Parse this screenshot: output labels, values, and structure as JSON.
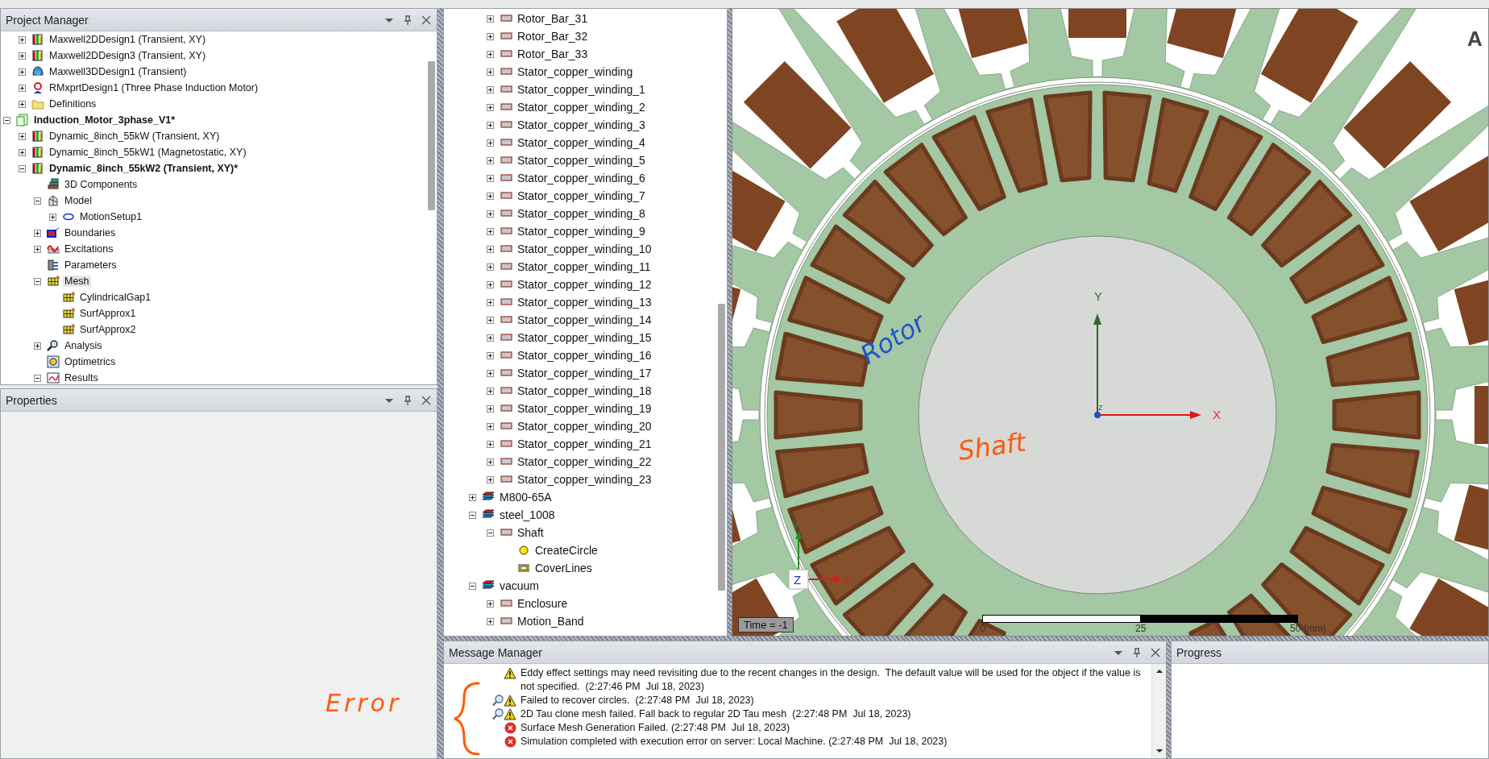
{
  "project_manager": {
    "title": "Project Manager",
    "continued_items": [
      {
        "label": "Maxwell2DDesign1 (Transient, XY)",
        "kind": "design2d",
        "expanded": false,
        "selected": false,
        "active": false
      },
      {
        "label": "Maxwell2DDesign3 (Transient, XY)",
        "kind": "design2d",
        "expanded": false,
        "selected": false,
        "active": false
      },
      {
        "label": "Maxwell3DDesign1 (Transient)",
        "kind": "design3d",
        "expanded": false,
        "selected": false,
        "active": false
      },
      {
        "label": "RMxprtDesign1 (Three Phase Induction Motor)",
        "kind": "rmxprt",
        "expanded": false,
        "selected": false,
        "active": false
      },
      {
        "label": "Definitions",
        "kind": "folder",
        "expanded": false,
        "selected": false,
        "active": false
      }
    ],
    "items": [
      {
        "label": "Induction_Motor_3phase_V1*",
        "kind": "project",
        "expanded": true,
        "selected": false,
        "active": true,
        "children": [
          {
            "label": "Dynamic_8inch_55kW (Transient, XY)",
            "kind": "design2d",
            "expanded": false,
            "selected": false,
            "active": false
          },
          {
            "label": "Dynamic_8inch_55kW1 (Magnetostatic, XY)",
            "kind": "design2d",
            "expanded": false,
            "selected": false,
            "active": false
          },
          {
            "label": "Dynamic_8inch_55kW2 (Transient, XY)*",
            "kind": "design2d",
            "expanded": true,
            "selected": false,
            "active": true,
            "children": [
              {
                "label": "3D Components",
                "kind": "components",
                "selected": false
              },
              {
                "label": "Model",
                "kind": "model",
                "expanded": true,
                "selected": false,
                "children": [
                  {
                    "label": "MotionSetup1",
                    "kind": "motion",
                    "expanded": false,
                    "selected": false
                  }
                ]
              },
              {
                "label": "Boundaries",
                "kind": "boundary",
                "expanded": false,
                "selected": false
              },
              {
                "label": "Excitations",
                "kind": "excitation",
                "expanded": false,
                "selected": false
              },
              {
                "label": "Parameters",
                "kind": "parameters",
                "selected": false
              },
              {
                "label": "Mesh",
                "kind": "mesh",
                "expanded": true,
                "selected": true,
                "children": [
                  {
                    "label": "CylindricalGap1",
                    "kind": "mesh",
                    "selected": false
                  },
                  {
                    "label": "SurfApprox1",
                    "kind": "mesh",
                    "selected": false
                  },
                  {
                    "label": "SurfApprox2",
                    "kind": "mesh",
                    "selected": false
                  }
                ]
              },
              {
                "label": "Analysis",
                "kind": "analysis",
                "expanded": false,
                "selected": false
              },
              {
                "label": "Optimetrics",
                "kind": "optimetrics",
                "selected": false
              },
              {
                "label": "Results",
                "kind": "results",
                "expanded": true,
                "selected": false
              }
            ]
          }
        ]
      }
    ]
  },
  "properties": {
    "title": "Properties"
  },
  "model_tree": {
    "continued_items": [
      {
        "label": "Rotor_Bar_31",
        "kind": "object",
        "expanded": false
      },
      {
        "label": "Rotor_Bar_32",
        "kind": "object",
        "expanded": false
      },
      {
        "label": "Rotor_Bar_33",
        "kind": "object",
        "expanded": false
      },
      {
        "label": "Stator_copper_winding",
        "kind": "object",
        "expanded": false
      },
      {
        "label": "Stator_copper_winding_1",
        "kind": "object",
        "expanded": false
      },
      {
        "label": "Stator_copper_winding_2",
        "kind": "object",
        "expanded": false
      },
      {
        "label": "Stator_copper_winding_3",
        "kind": "object",
        "expanded": false
      },
      {
        "label": "Stator_copper_winding_4",
        "kind": "object",
        "expanded": false
      },
      {
        "label": "Stator_copper_winding_5",
        "kind": "object",
        "expanded": false
      },
      {
        "label": "Stator_copper_winding_6",
        "kind": "object",
        "expanded": false
      },
      {
        "label": "Stator_copper_winding_7",
        "kind": "object",
        "expanded": false
      },
      {
        "label": "Stator_copper_winding_8",
        "kind": "object",
        "expanded": false
      },
      {
        "label": "Stator_copper_winding_9",
        "kind": "object",
        "expanded": false
      },
      {
        "label": "Stator_copper_winding_10",
        "kind": "object",
        "expanded": false
      },
      {
        "label": "Stator_copper_winding_11",
        "kind": "object",
        "expanded": false
      },
      {
        "label": "Stator_copper_winding_12",
        "kind": "object",
        "expanded": false
      },
      {
        "label": "Stator_copper_winding_13",
        "kind": "object",
        "expanded": false
      },
      {
        "label": "Stator_copper_winding_14",
        "kind": "object",
        "expanded": false
      },
      {
        "label": "Stator_copper_winding_15",
        "kind": "object",
        "expanded": false
      },
      {
        "label": "Stator_copper_winding_16",
        "kind": "object",
        "expanded": false
      },
      {
        "label": "Stator_copper_winding_17",
        "kind": "object",
        "expanded": false
      },
      {
        "label": "Stator_copper_winding_18",
        "kind": "object",
        "expanded": false
      },
      {
        "label": "Stator_copper_winding_19",
        "kind": "object",
        "expanded": false
      },
      {
        "label": "Stator_copper_winding_20",
        "kind": "object",
        "expanded": false
      },
      {
        "label": "Stator_copper_winding_21",
        "kind": "object",
        "expanded": false
      },
      {
        "label": "Stator_copper_winding_22",
        "kind": "object",
        "expanded": false
      },
      {
        "label": "Stator_copper_winding_23",
        "kind": "object",
        "expanded": false
      }
    ],
    "items": [
      {
        "label": "M800-65A",
        "kind": "material",
        "expanded": false
      },
      {
        "label": "steel_1008",
        "kind": "material",
        "expanded": true,
        "children": [
          {
            "label": "Shaft",
            "kind": "object",
            "expanded": true,
            "children": [
              {
                "label": "CreateCircle",
                "kind": "circle"
              },
              {
                "label": "CoverLines",
                "kind": "lines"
              }
            ]
          }
        ]
      },
      {
        "label": "vacuum",
        "kind": "material",
        "expanded": true,
        "children": [
          {
            "label": "Enclosure",
            "kind": "object",
            "expanded": false
          },
          {
            "label": "Motion_Band",
            "kind": "object",
            "expanded": false
          }
        ]
      }
    ]
  },
  "viewport": {
    "corner_label": "A",
    "y_label": "Y",
    "x_label": "X",
    "origin_label": "Z",
    "annotations": [
      "Rotor",
      "Shaft"
    ],
    "triad": {
      "z": "Z",
      "y": "Y",
      "x": "X"
    },
    "time": "Time = -1",
    "scale_labels": [
      "0",
      "25",
      "50 (mm)"
    ]
  },
  "message_manager": {
    "title": "Message Manager",
    "annotation": "Error",
    "messages": [
      {
        "kind": "warning",
        "details": false,
        "text": "Eddy effect settings may need revisiting due to the recent changes in the design.  The default value will be used for the object if the value is not specified.  (2:27:46 PM  Jul 18, 2023)"
      },
      {
        "kind": "warning",
        "details": true,
        "text": "Failed to recover circles.  (2:27:48 PM  Jul 18, 2023)"
      },
      {
        "kind": "warning",
        "details": true,
        "text": "2D Tau clone mesh failed. Fall back to regular 2D Tau mesh  (2:27:48 PM  Jul 18, 2023)"
      },
      {
        "kind": "error",
        "details": false,
        "text": "Surface Mesh Generation Failed. (2:27:48 PM  Jul 18, 2023)"
      },
      {
        "kind": "error",
        "details": false,
        "text": "Simulation completed with execution error on server: Local Machine. (2:27:48 PM  Jul 18, 2023)"
      }
    ]
  },
  "progress": {
    "title": "Progress"
  }
}
